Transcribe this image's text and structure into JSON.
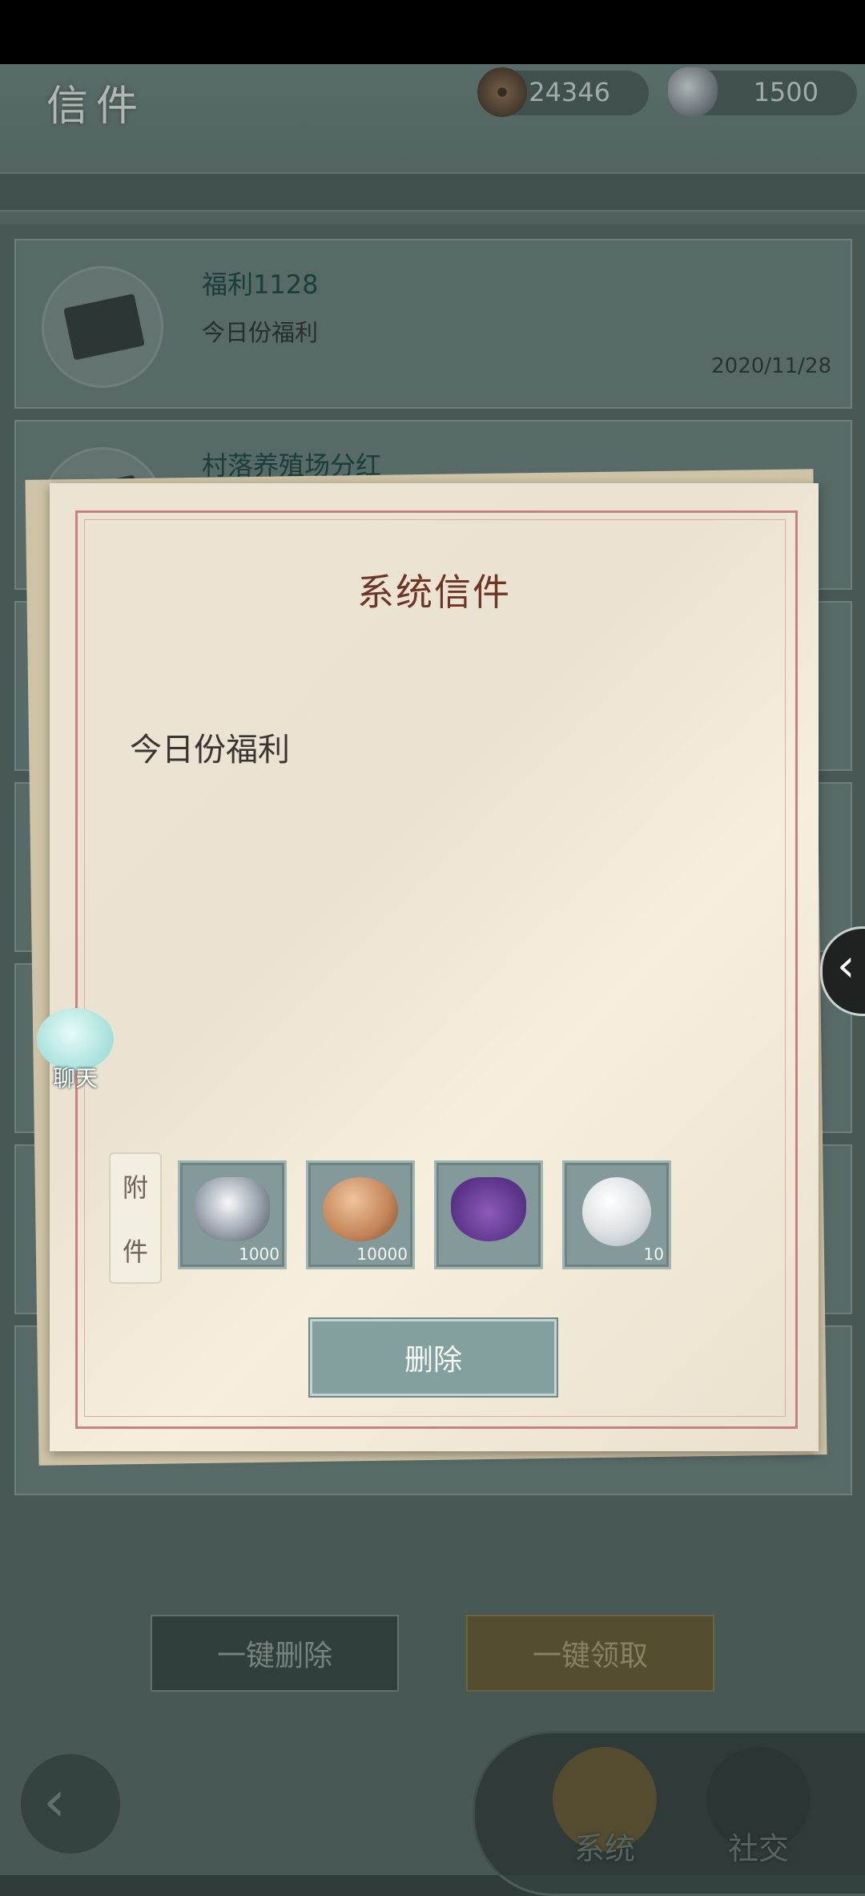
{
  "header": {
    "title": "信件"
  },
  "currency": {
    "coins": "24346",
    "silver": "1500"
  },
  "mail_list": [
    {
      "title": "福利1128",
      "subtitle": "今日份福利",
      "date": "2020/11/28"
    },
    {
      "title": "村落养殖场分红"
    }
  ],
  "letter": {
    "title": "系统信件",
    "body": "今日份福利",
    "attach_label_1": "附",
    "attach_label_2": "件",
    "attachments": [
      {
        "icon": "silver-ingot-icon",
        "qty": "1000"
      },
      {
        "icon": "copper-coin-icon",
        "qty": "10000"
      },
      {
        "icon": "purple-pouch-icon",
        "qty": ""
      },
      {
        "icon": "pearl-icon",
        "qty": "10"
      }
    ],
    "delete_label": "删除"
  },
  "chat": {
    "label": "聊天"
  },
  "bottom": {
    "delete_all": "一键删除",
    "claim_all": "一键领取"
  },
  "tabs": {
    "system": "系统",
    "social": "社交"
  },
  "colors": {
    "paper": "#ece4d3",
    "frame": "#c98080",
    "accent_teal": "#83a09e",
    "title_red": "#6e3424"
  }
}
